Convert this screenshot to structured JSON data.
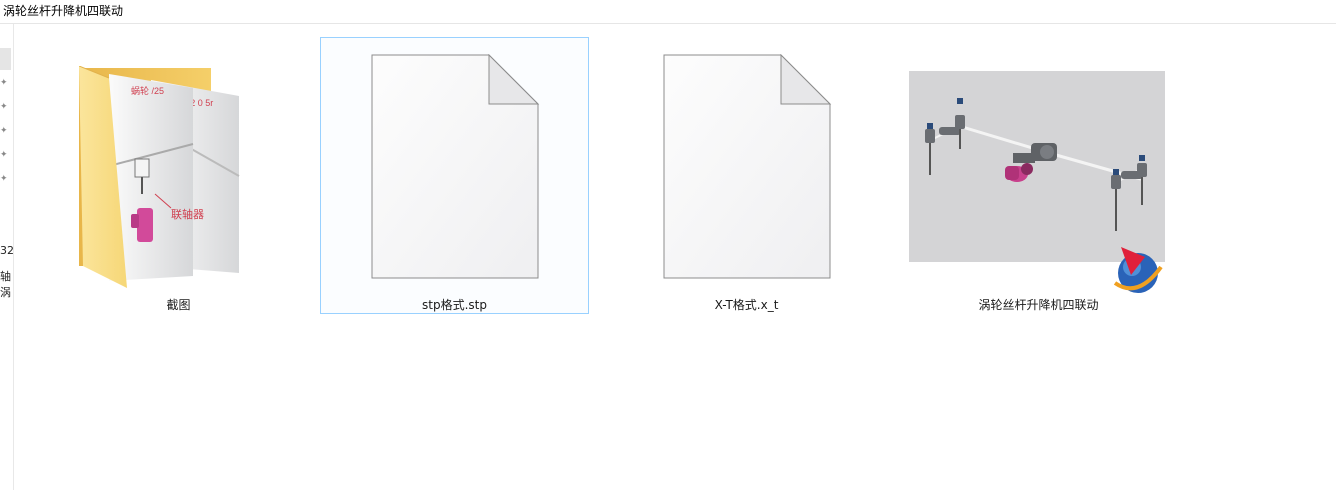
{
  "window": {
    "title": "涡轮丝杆升降机四联动"
  },
  "nav": {
    "truncated_lines": [
      "32",
      "轴涡"
    ]
  },
  "files": [
    {
      "name": "截图",
      "type": "folder",
      "icon": "folder-icon",
      "selected": false
    },
    {
      "name": "stp格式.stp",
      "type": "file",
      "icon": "blank-document-icon",
      "selected": true
    },
    {
      "name": "X-T格式.x_t",
      "type": "file",
      "icon": "blank-document-icon",
      "selected": false
    },
    {
      "name": "涡轮丝杆升降机四联动",
      "type": "assembly",
      "icon": "nx-assembly-icon",
      "selected": false
    }
  ],
  "colors": {
    "selection_border": "#99d1ff",
    "folder_yellow": "#f7d675",
    "thumbnail_bg": "#d4d4d6",
    "magenta_part": "#c8408c"
  }
}
